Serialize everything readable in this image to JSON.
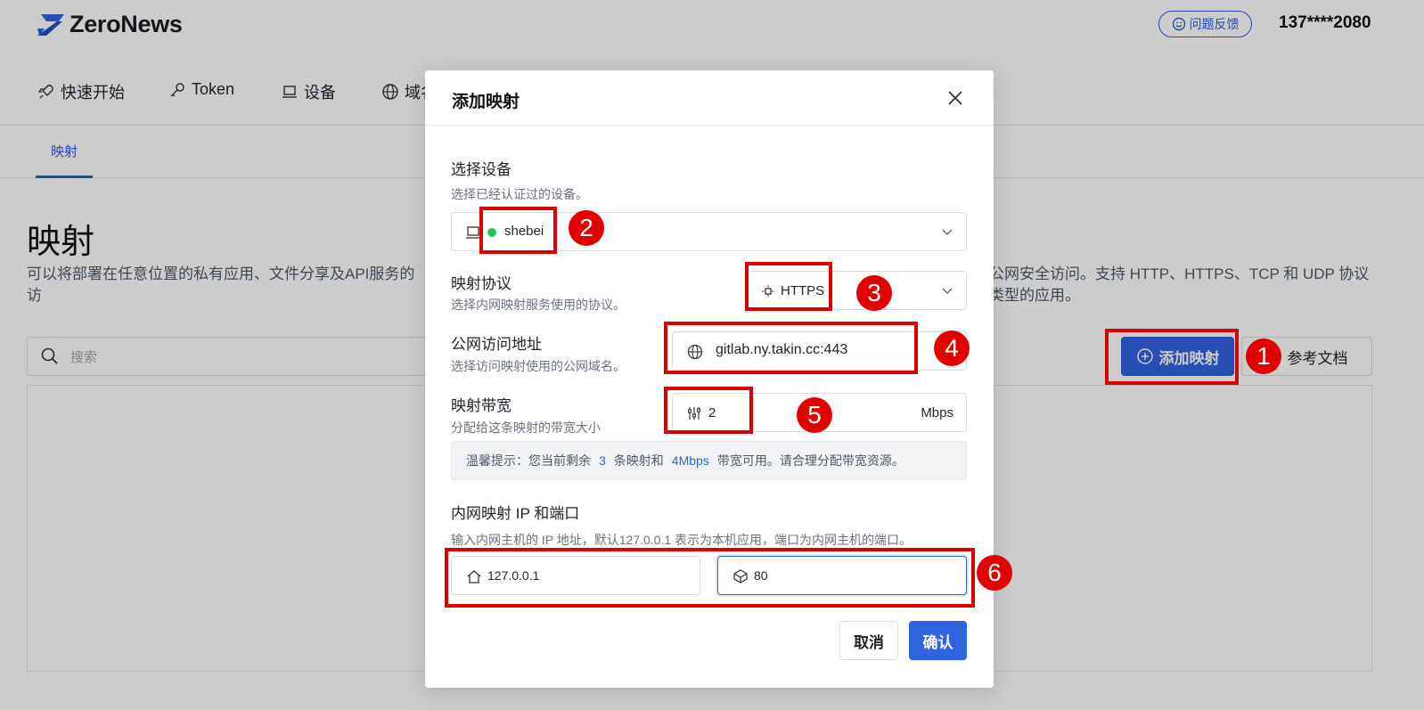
{
  "app": {
    "brand": "ZeroNews",
    "feedback_label": "问题反馈",
    "user_phone": "137****2080"
  },
  "nav": {
    "items": [
      {
        "label": "快速开始",
        "icon": "rocket-icon"
      },
      {
        "label": "Token",
        "icon": "key-icon"
      },
      {
        "label": "设备",
        "icon": "laptop-icon"
      },
      {
        "label": "域名",
        "icon": "globe-icon"
      }
    ]
  },
  "subnav": {
    "active_tab": "映射"
  },
  "page": {
    "title": "映射",
    "description_left": "可以将部署在任意位置的私有应用、文件分享及API服务的访",
    "description_right": "公网安全访问。支持 HTTP、HTTPS、TCP 和 UDP 协议类型的应用。",
    "search_placeholder": "搜索",
    "add_button": "添加映射",
    "docs_button": "参考文档"
  },
  "modal": {
    "title": "添加映射",
    "device": {
      "label": "选择设备",
      "hint": "选择已经认证过的设备。",
      "selected": "shebei",
      "status_color": "#22c55e"
    },
    "protocol": {
      "label": "映射协议",
      "hint": "选择内网映射服务使用的协议。",
      "selected": "HTTPS"
    },
    "public_address": {
      "label": "公网访问地址",
      "hint": "选择访问映射使用的公网域名。",
      "value": "gitlab.ny.takin.cc:443"
    },
    "bandwidth": {
      "label": "映射带宽",
      "hint": "分配给这条映射的带宽大小",
      "value": "2",
      "unit": "Mbps"
    },
    "tip": {
      "prefix": "温馨提示：您当前剩余",
      "mappings_left": "3",
      "middle": "条映射和",
      "bandwidth_left": "4Mbps",
      "suffix": "带宽可用。请合理分配带宽资源。"
    },
    "internal": {
      "label": "内网映射 IP 和端口",
      "hint": "输入内网主机的 IP 地址，默认127.0.0.1 表示为本机应用，端口为内网主机的端口。",
      "ip": "127.0.0.1",
      "port": "80"
    },
    "cancel_label": "取消",
    "confirm_label": "确认"
  },
  "annotations": {
    "markers": [
      "1",
      "2",
      "3",
      "4",
      "5",
      "6"
    ],
    "color": "#d90000"
  },
  "colors": {
    "accent": "#2f63e0",
    "status_online": "#22c55e"
  }
}
